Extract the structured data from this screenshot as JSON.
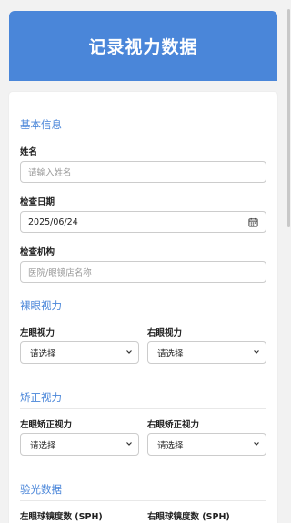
{
  "header": {
    "title": "记录视力数据"
  },
  "sections": {
    "basic": "基本信息",
    "naked": "裸眼视力",
    "corrected": "矫正视力",
    "optometry": "验光数据"
  },
  "fields": {
    "name": {
      "label": "姓名",
      "placeholder": "请输入姓名"
    },
    "date": {
      "label": "检查日期",
      "value": "2025/06/24"
    },
    "institution": {
      "label": "检查机构",
      "placeholder": "医院/眼镜店名称"
    },
    "left_naked": {
      "label": "左眼视力",
      "value": "请选择"
    },
    "right_naked": {
      "label": "右眼视力",
      "value": "请选择"
    },
    "left_corrected": {
      "label": "左眼矫正视力",
      "value": "请选择"
    },
    "right_corrected": {
      "label": "右眼矫正视力",
      "value": "请选择"
    },
    "left_sph": {
      "label": "左眼球镜度数 (SPH)"
    },
    "right_sph": {
      "label": "右眼球镜度数 (SPH)"
    }
  },
  "icons": {
    "calendar": "calendar-icon",
    "chevron": "chevron-down-icon"
  },
  "colors": {
    "accent": "#4a86d9"
  }
}
